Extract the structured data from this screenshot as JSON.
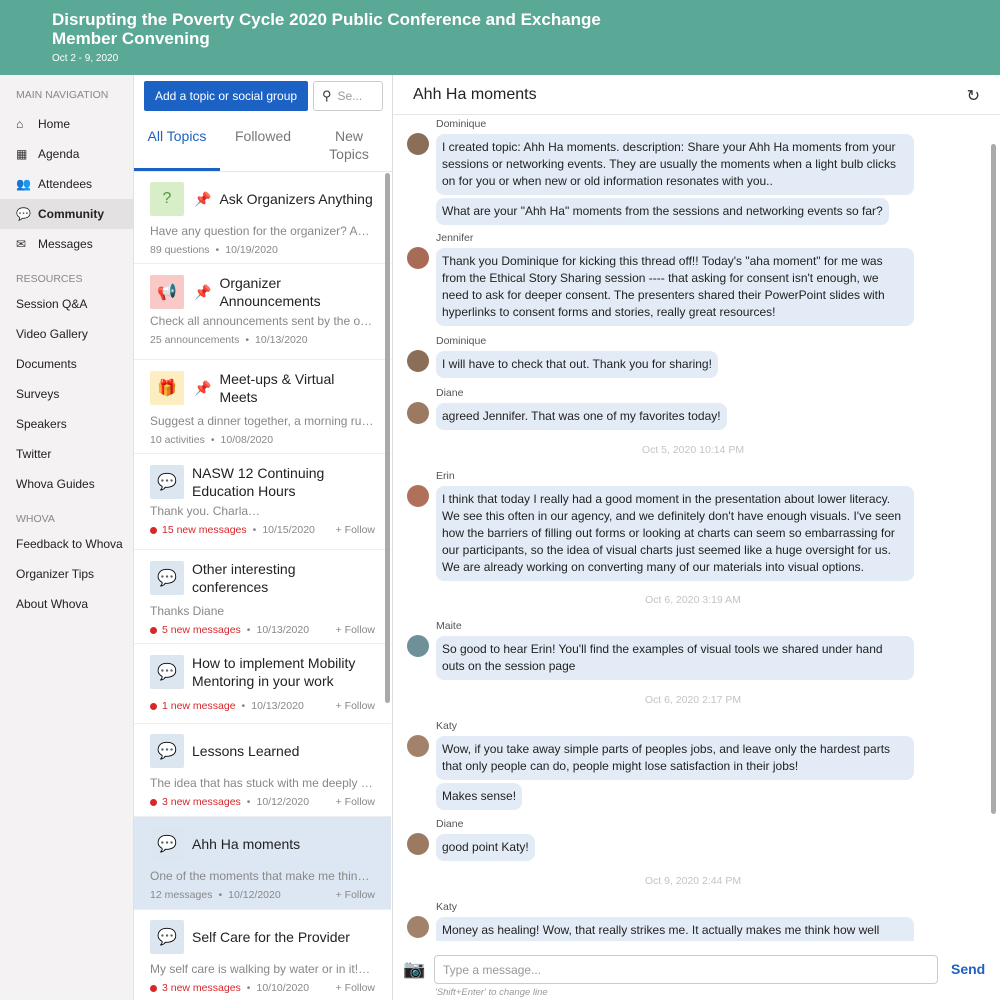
{
  "header": {
    "title": "Disrupting the Poverty Cycle 2020 Public Conference and Exchange Member Convening",
    "dates": "Oct 2 - 9, 2020"
  },
  "nav": {
    "main_heading": "MAIN NAVIGATION",
    "main_items": [
      {
        "label": "Home",
        "icon": "home-icon"
      },
      {
        "label": "Agenda",
        "icon": "calendar-icon"
      },
      {
        "label": "Attendees",
        "icon": "users-icon"
      },
      {
        "label": "Community",
        "icon": "chat-bubbles-icon"
      },
      {
        "label": "Messages",
        "icon": "envelope-icon"
      }
    ],
    "resources_heading": "RESOURCES",
    "resources_items": [
      "Session Q&A",
      "Video Gallery",
      "Documents",
      "Surveys",
      "Speakers",
      "Twitter",
      "Whova Guides"
    ],
    "whova_heading": "WHOVA",
    "whova_items": [
      "Feedback to Whova",
      "Organizer Tips",
      "About Whova"
    ]
  },
  "middle": {
    "add_button": "Add a topic or social group",
    "search_placeholder": "Se...",
    "tabs": [
      "All Topics",
      "Followed",
      "New Topics"
    ],
    "topics": [
      {
        "title": "Ask Organizers Anything",
        "desc": "Have any question for the organizer? Ask them here!",
        "meta": "89 questions",
        "date": "10/19/2020",
        "pinned": true,
        "icon": "question-icon",
        "color": "green"
      },
      {
        "title": "Organizer Announcements",
        "desc": "Check all announcements sent by the organizers",
        "meta": "25 announcements",
        "date": "10/13/2020",
        "pinned": true,
        "icon": "megaphone-icon",
        "color": "red"
      },
      {
        "title": "Meet-ups & Virtual Meets",
        "desc": "Suggest a dinner together, a morning run, and more",
        "meta": "10 activities",
        "date": "10/08/2020",
        "pinned": true,
        "icon": "gift-icon",
        "color": "yellow"
      },
      {
        "title": "NASW 12 Continuing Education Hours",
        "desc": "Thank you. Charla…",
        "meta": "15 new messages",
        "date": "10/15/2020",
        "new": true,
        "follow": "+ Follow"
      },
      {
        "title": "Other interesting conferences",
        "desc": "Thanks Diane",
        "meta": "5 new messages",
        "date": "10/13/2020",
        "new": true,
        "follow": "+ Follow"
      },
      {
        "title": "How to implement Mobility Mentoring in your work",
        "desc": "",
        "meta": "1 new message",
        "date": "10/13/2020",
        "new": true,
        "follow": "+ Follow"
      },
      {
        "title": "Lessons Learned",
        "desc": "The idea that has stuck with me deeply is the idea",
        "meta": "3 new messages",
        "date": "10/12/2020",
        "new": true,
        "follow": "+ Follow"
      },
      {
        "title": "Ahh Ha moments",
        "desc": "One of the moments that make me think about my work",
        "meta": "12 messages",
        "date": "10/12/2020",
        "new": false,
        "follow": "+ Follow",
        "selected": true
      },
      {
        "title": "Self Care for the Provider",
        "desc": "My self care is walking by water or in it!…",
        "meta": "3 new messages",
        "date": "10/10/2020",
        "new": true,
        "follow": "+ Follow"
      }
    ]
  },
  "chat": {
    "title": "Ahh Ha moments",
    "messages": [
      {
        "author": "Dominique",
        "bubbles": [
          "I created topic: Ahh Ha moments. description: Share your Ahh Ha moments from your sessions or networking events. They are usually the moments when a light bulb clicks on for you or when new or old information resonates with you..",
          "What are your \"Ahh Ha\" moments from the sessions and networking events so far?"
        ]
      },
      {
        "author": "Jennifer",
        "bubbles": [
          "Thank you Dominique for kicking this thread off!! Today's \"aha moment\" for me was from the Ethical Story Sharing session ---- that asking for consent isn't enough, we need to ask for deeper consent. The presenters shared their PowerPoint slides with hyperlinks to consent forms and stories, really great resources!"
        ]
      },
      {
        "author": "Dominique",
        "bubbles": [
          "I will have to check that out. Thank you for sharing!"
        ]
      },
      {
        "author": "Diane",
        "bubbles": [
          "agreed Jennifer. That was one of my favorites today!"
        ]
      },
      {
        "timestamp": "Oct 5, 2020 10:14 PM"
      },
      {
        "author": "Erin",
        "bubbles": [
          "I think that today I really had a good moment in the presentation about lower literacy. We see this often in our agency, and we definitely don't have enough visuals. I've seen how the barriers of filling out forms or looking at charts can seem so embarrassing for our participants, so the idea of visual charts just seemed like a huge oversight for us. We are already working on converting many of our materials into visual options."
        ]
      },
      {
        "timestamp": "Oct 6, 2020 3:19 AM"
      },
      {
        "author": "Maite",
        "bubbles": [
          "So good to hear Erin! You'll find the examples of visual tools we shared under hand outs on the session page"
        ]
      },
      {
        "timestamp": "Oct 6, 2020 2:17 PM"
      },
      {
        "author": "Katy",
        "bubbles": [
          "Wow, if you take away simple parts of peoples jobs, and leave only the hardest parts that only people can do, people might lose satisfaction in their jobs!",
          "Makes sense!"
        ]
      },
      {
        "author": "Diane",
        "bubbles": [
          "good point Katy!"
        ]
      },
      {
        "timestamp": "Oct 9, 2020 2:44 PM"
      },
      {
        "author": "Katy",
        "bubbles": [
          "Money as healing! Wow, that really strikes me. It actually makes me think how well"
        ]
      }
    ],
    "input_placeholder": "Type a message...",
    "send_label": "Send",
    "hint": "'Shift+Enter' to change line"
  },
  "colors": {
    "header": "#5aa896",
    "accent": "#1c62c4",
    "bubble": "#e3ecf6",
    "alert": "#d8262b"
  }
}
